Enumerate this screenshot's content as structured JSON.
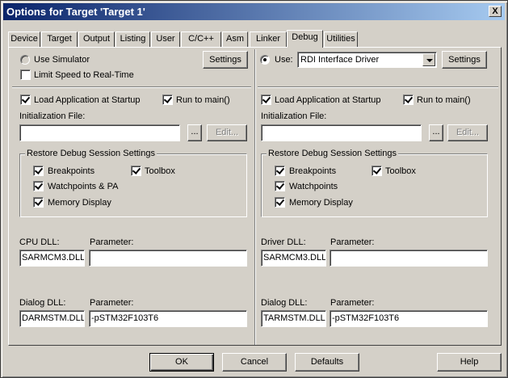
{
  "window": {
    "title": "Options for Target 'Target 1'",
    "close_glyph": "X"
  },
  "tabs": [
    {
      "label": "Device"
    },
    {
      "label": "Target"
    },
    {
      "label": "Output"
    },
    {
      "label": "Listing"
    },
    {
      "label": "User"
    },
    {
      "label": "C/C++"
    },
    {
      "label": "Asm"
    },
    {
      "label": "Linker"
    },
    {
      "label": "Debug",
      "active": true
    },
    {
      "label": "Utilities"
    }
  ],
  "left": {
    "use_simulator": "Use Simulator",
    "limit_speed": "Limit Speed to Real-Time",
    "settings": "Settings",
    "load_app": "Load Application at Startup",
    "run_to_main": "Run to main()",
    "init_file": "Initialization File:",
    "browse": "...",
    "edit": "Edit...",
    "restore_group": "Restore Debug Session Settings",
    "breakpoints": "Breakpoints",
    "toolbox": "Toolbox",
    "watchpoints": "Watchpoints & PA",
    "memory_display": "Memory Display",
    "dll_label": "CPU DLL:",
    "dll_param_label": "Parameter:",
    "dll_value": "SARMCM3.DLL",
    "dll_param_value": "",
    "dialog_dll_label": "Dialog DLL:",
    "dialog_param_label": "Parameter:",
    "dialog_dll_value": "DARMSTM.DLL",
    "dialog_param_value": "-pSTM32F103T6"
  },
  "right": {
    "use": "Use:",
    "driver": "RDI Interface Driver",
    "settings": "Settings",
    "load_app": "Load Application at Startup",
    "run_to_main": "Run to main()",
    "init_file": "Initialization File:",
    "browse": "...",
    "edit": "Edit...",
    "restore_group": "Restore Debug Session Settings",
    "breakpoints": "Breakpoints",
    "toolbox": "Toolbox",
    "watchpoints": "Watchpoints",
    "memory_display": "Memory Display",
    "dll_label": "Driver DLL:",
    "dll_param_label": "Parameter:",
    "dll_value": "SARMCM3.DLL",
    "dll_param_value": "",
    "dialog_dll_label": "Dialog DLL:",
    "dialog_param_label": "Parameter:",
    "dialog_dll_value": "TARMSTM.DLL",
    "dialog_param_value": "-pSTM32F103T6"
  },
  "footer": {
    "ok": "OK",
    "cancel": "Cancel",
    "defaults": "Defaults",
    "help": "Help"
  }
}
